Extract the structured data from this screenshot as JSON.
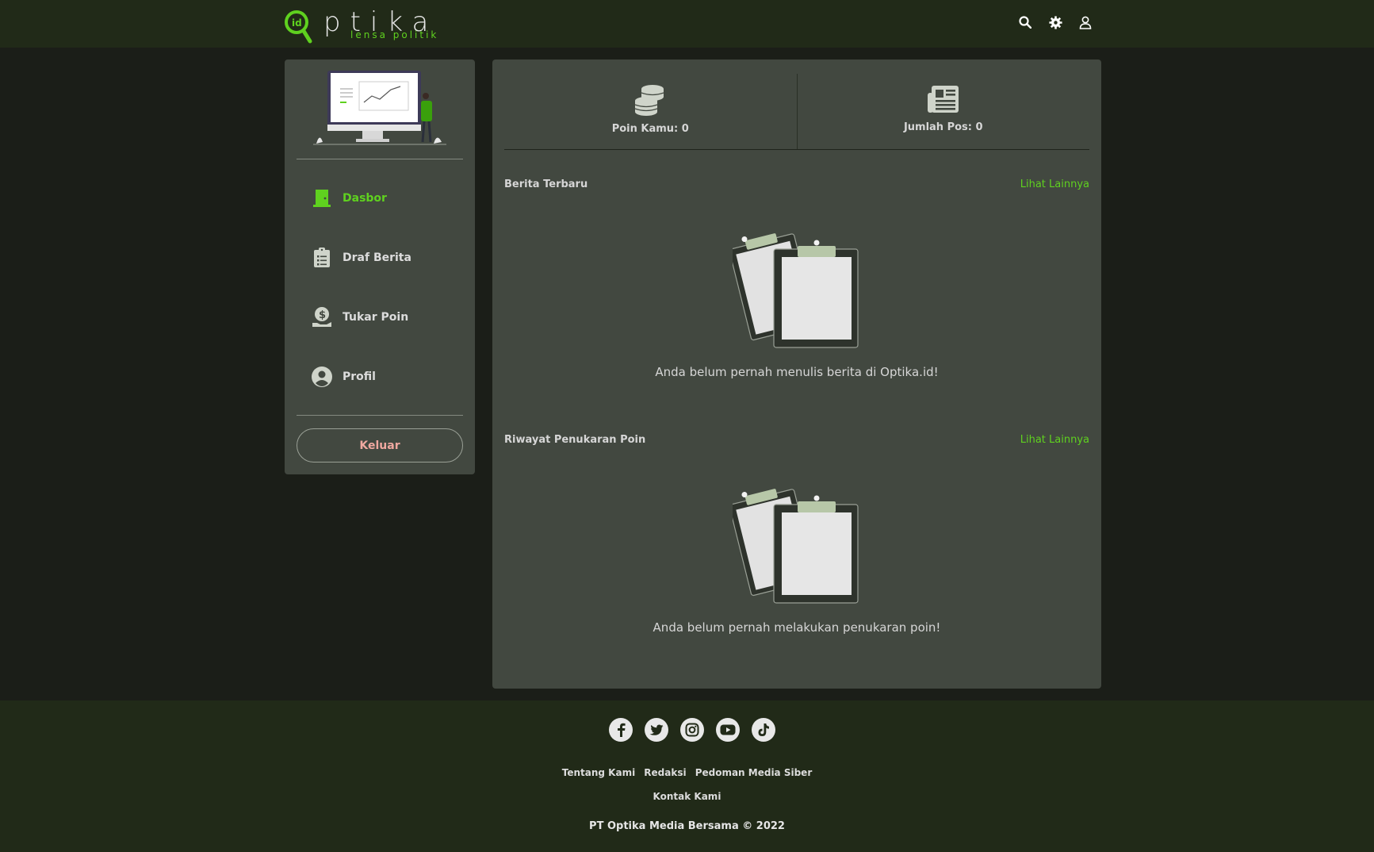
{
  "header": {
    "logo_text": "ptika",
    "logo_tagline": "lensa politik",
    "logo_badge": "id",
    "icons": [
      "search-icon",
      "gear-icon",
      "user-icon"
    ]
  },
  "sidebar": {
    "items": [
      {
        "label": "Dasbor",
        "icon": "door-icon",
        "active": true
      },
      {
        "label": "Draf Berita",
        "icon": "clipboard-list-icon",
        "active": false
      },
      {
        "label": "Tukar Poin",
        "icon": "money-hand-icon",
        "active": false
      },
      {
        "label": "Profil",
        "icon": "user-circle-icon",
        "active": false
      }
    ],
    "logout_label": "Keluar"
  },
  "stats": {
    "points_label": "Poin Kamu: 0",
    "posts_label": "Jumlah Pos: 0"
  },
  "sections": {
    "news": {
      "title": "Berita Terbaru",
      "see_more": "Lihat Lainnya",
      "empty_text": "Anda belum pernah menulis berita di Optika.id!"
    },
    "history": {
      "title": "Riwayat Penukaran Poin",
      "see_more": "Lihat Lainnya",
      "empty_text": "Anda belum pernah melakukan penukaran poin!"
    }
  },
  "footer": {
    "socials": [
      "facebook-icon",
      "twitter-icon",
      "instagram-icon",
      "youtube-icon",
      "tiktok-icon"
    ],
    "links_row1": [
      "Tentang Kami",
      "Redaksi",
      "Pedoman Media Siber"
    ],
    "links_row2": [
      "Kontak Kami"
    ],
    "copyright": "PT Optika Media Bersama © 2022"
  },
  "colors": {
    "accent": "#5fd11f",
    "header_bg": "#212a18",
    "page_bg": "#1b1e18",
    "panel_bg": "#424840",
    "logout_text": "#f0a8a0"
  }
}
